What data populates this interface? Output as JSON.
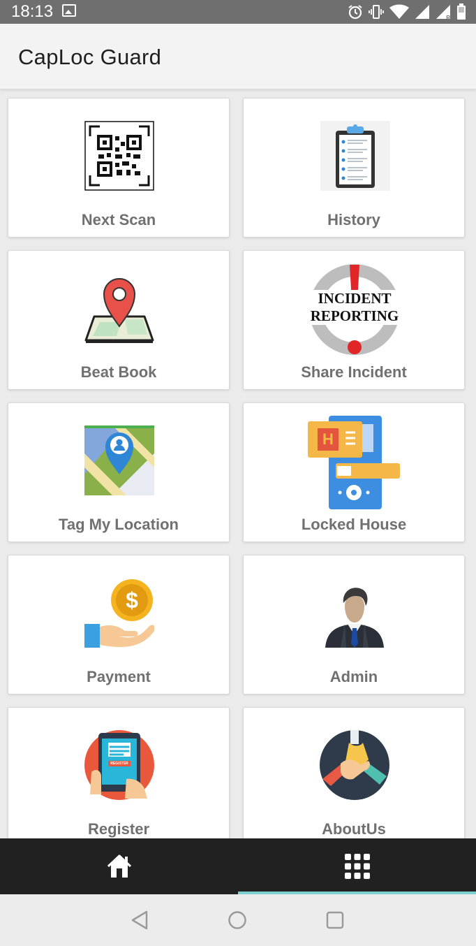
{
  "status_bar": {
    "time": "18:13",
    "left_icons": [
      "image-icon"
    ],
    "right_icons": [
      "alarm-icon",
      "vibrate-icon",
      "wifi-icon",
      "signal-icon",
      "signal-roaming-icon",
      "battery-icon"
    ],
    "roaming_letter": "R"
  },
  "app_bar": {
    "title": "CapLoc Guard"
  },
  "menu": {
    "items": [
      {
        "label": "Next Scan",
        "icon": "qr-code-scan-icon"
      },
      {
        "label": "History",
        "icon": "clipboard-checklist-icon"
      },
      {
        "label": "Beat Book",
        "icon": "map-pin-icon"
      },
      {
        "label": "Share Incident",
        "icon": "incident-reporting-icon",
        "icon_text_line1": "INCIDENT",
        "icon_text_line2": "REPORTING"
      },
      {
        "label": "Tag My Location",
        "icon": "location-map-icon"
      },
      {
        "label": "Locked House",
        "icon": "hotel-door-lock-icon",
        "icon_letter": "H"
      },
      {
        "label": "Payment",
        "icon": "payment-coin-hand-icon",
        "icon_symbol": "$"
      },
      {
        "label": "Admin",
        "icon": "admin-businessman-icon"
      },
      {
        "label": "Register",
        "icon": "register-tablet-icon",
        "icon_text": "REGISTER"
      },
      {
        "label": "AboutUs",
        "icon": "about-us-hands-icon"
      }
    ]
  },
  "bottom_nav": {
    "items": [
      {
        "icon": "home-icon",
        "selected": false
      },
      {
        "icon": "grid-menu-icon",
        "selected": true
      }
    ],
    "indicator_color": "#7fd0d0"
  },
  "system_nav": {
    "buttons": [
      "back-icon",
      "home-circle-icon",
      "recents-icon"
    ]
  },
  "colors": {
    "status_bar": "#6f6f6f",
    "app_bar": "#f3f3f3",
    "background": "#ebebeb",
    "bottom_nav": "#212121",
    "label": "#707070"
  }
}
